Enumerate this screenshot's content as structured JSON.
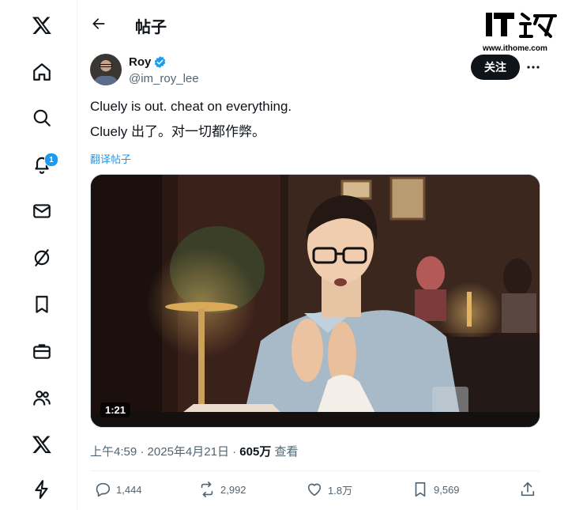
{
  "header": {
    "title": "帖子"
  },
  "watermark": {
    "brand": "IT之家",
    "url": "www.ithome.com"
  },
  "notifications": {
    "badge": "1"
  },
  "post": {
    "author": {
      "name": "Roy",
      "handle": "@im_roy_lee"
    },
    "follow_label": "关注",
    "text_en": "Cluely is out. cheat on everything.",
    "text_zh": "Cluely 出了。对一切都作弊。",
    "translate_label": "翻译帖子",
    "video": {
      "duration": "1:21"
    },
    "time": "上午4:59",
    "sep1": "·",
    "date": "2025年4月21日",
    "sep2": "·",
    "views": "605万",
    "views_label": "查看",
    "stats": {
      "replies": "1,444",
      "reposts": "2,992",
      "likes": "1.8万",
      "bookmarks": "9,569"
    }
  },
  "colors": {
    "accent": "#1d9bf0",
    "text": "#0f1419",
    "secondary": "#536471",
    "border": "#eff3f4"
  }
}
